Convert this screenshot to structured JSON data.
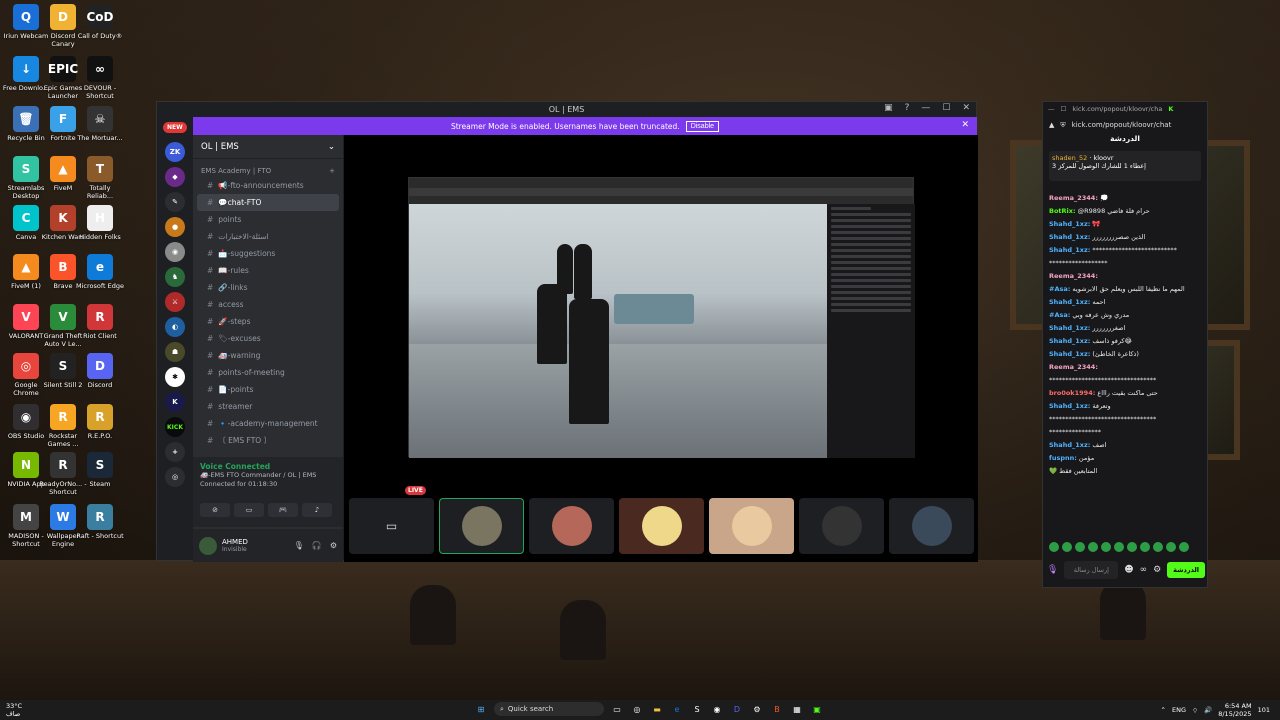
{
  "desktop_icons": [
    {
      "label": "Iriun Webcam",
      "color": "#1a6fd6",
      "glyph": "Q"
    },
    {
      "label": "Discord Canary",
      "color": "#f0b232",
      "glyph": "D"
    },
    {
      "label": "Call of Duty®",
      "color": "#222",
      "glyph": "CoD"
    },
    {
      "label": "Free Downlo...",
      "color": "#1787e0",
      "glyph": "↓"
    },
    {
      "label": "Epic Games Launcher",
      "color": "#111",
      "glyph": "EPIC"
    },
    {
      "label": "DEVOUR - Shortcut",
      "color": "#111",
      "glyph": "∞"
    },
    {
      "label": "Recycle Bin",
      "color": "#3b6fb6",
      "glyph": "🗑"
    },
    {
      "label": "Fortnite",
      "color": "#3aa0e8",
      "glyph": "F"
    },
    {
      "label": "The Mortuar...",
      "color": "#333",
      "glyph": "☠"
    },
    {
      "label": "Streamlabs Desktop",
      "color": "#31c3a2",
      "glyph": "S"
    },
    {
      "label": "FiveM",
      "color": "#f58a1f",
      "glyph": "▲"
    },
    {
      "label": "Totally Reliab...",
      "color": "#8a5a2a",
      "glyph": "T"
    },
    {
      "label": "Canva",
      "color": "#00c4cc",
      "glyph": "C"
    },
    {
      "label": "Kitchen Wars",
      "color": "#b3402a",
      "glyph": "K"
    },
    {
      "label": "Hidden Folks",
      "color": "#eee",
      "glyph": "H"
    },
    {
      "label": "FiveM (1)",
      "color": "#f58a1f",
      "glyph": "▲"
    },
    {
      "label": "Brave",
      "color": "#fb542b",
      "glyph": "B"
    },
    {
      "label": "Microsoft Edge",
      "color": "#0f7bd8",
      "glyph": "e"
    },
    {
      "label": "VALORANT",
      "color": "#fd4556",
      "glyph": "V"
    },
    {
      "label": "Grand Theft Auto V Le...",
      "color": "#2a8c3a",
      "glyph": "V"
    },
    {
      "label": "Riot Client",
      "color": "#d13639",
      "glyph": "R"
    },
    {
      "label": "Google Chrome",
      "color": "#e8453c",
      "glyph": "◎"
    },
    {
      "label": "Silent Still 2",
      "color": "#222",
      "glyph": "S"
    },
    {
      "label": "Discord",
      "color": "#5865f2",
      "glyph": "D"
    },
    {
      "label": "OBS Studio",
      "color": "#302e31",
      "glyph": "◉"
    },
    {
      "label": "Rockstar Games ...",
      "color": "#f6a623",
      "glyph": "R"
    },
    {
      "label": "R.E.P.O.",
      "color": "#d8a22a",
      "glyph": "R"
    },
    {
      "label": "NVIDIA App",
      "color": "#76b900",
      "glyph": "N"
    },
    {
      "label": "ReadyOrNo... - Shortcut",
      "color": "#333",
      "glyph": "R"
    },
    {
      "label": "Steam",
      "color": "#1b2838",
      "glyph": "S"
    },
    {
      "label": "MADISON - Shortcut",
      "color": "#444",
      "glyph": "M"
    },
    {
      "label": "Wallpaper Engine",
      "color": "#2c7be5",
      "glyph": "W"
    },
    {
      "label": "Raft - Shortcut",
      "color": "#3a7fa0",
      "glyph": "R"
    }
  ],
  "discord": {
    "window_title": "OL | EMS",
    "streamer_banner": "Streamer Mode is enabled. Usernames have been truncated.",
    "disable_label": "Disable",
    "new_tag": "NEW",
    "server_name": "OL | EMS",
    "category": "EMS Academy | FTO",
    "channels": [
      {
        "name": "📢-fto-announcements",
        "active": false
      },
      {
        "name": "💬chat-FTO",
        "active": true
      },
      {
        "name": "points",
        "active": false
      },
      {
        "name": "اسئلة-الاختبارات",
        "active": false
      },
      {
        "name": "📩-suggestions",
        "active": false
      },
      {
        "name": "📖-rules",
        "active": false
      },
      {
        "name": "🔗-links",
        "active": false
      },
      {
        "name": "access",
        "active": false
      },
      {
        "name": "🚀-steps",
        "active": false
      },
      {
        "name": "🏷-excuses",
        "active": false
      },
      {
        "name": "🚑-warning",
        "active": false
      },
      {
        "name": "points-of-meeting",
        "active": false
      },
      {
        "name": "📄-points",
        "active": false
      },
      {
        "name": "streamer",
        "active": false
      },
      {
        "name": "🔹-academy-management",
        "active": false
      },
      {
        "name": "〔 EMS FTO 〕",
        "active": false
      }
    ],
    "voice": {
      "title": "Voice Connected",
      "channel": "🚑-EMS FTO Commander / OL | EMS",
      "timer": "Connected for 01:18:30"
    },
    "user": {
      "name": "AHMED",
      "status": "Invisible"
    },
    "live_label": "LIVE"
  },
  "kick": {
    "url": "kick.com/popout/kloovr/chat",
    "header": "الدردشة",
    "pinned": {
      "user": "shaden_52",
      "streamer": "kloovr",
      "text": "إعطاء 1 للشارك الوصول للمركز 3"
    },
    "messages": [
      {
        "user": "Reema_2344:",
        "text": "💭",
        "color": "#f4a3c0"
      },
      {
        "user": "BotRix:",
        "text": "@R9898 حرام فلة فاضي",
        "color": "#53fc18"
      },
      {
        "user": "Shahd_1xz:",
        "text": "🎀",
        "color": "#4fb3ff"
      },
      {
        "user": "Shahd_1xz:",
        "text": "الذين صصرررررررر",
        "color": "#4fb3ff"
      },
      {
        "user": "Shahd_1xz:",
        "text": "**************************",
        "color": "#4fb3ff"
      },
      {
        "user": "",
        "text": "******************",
        "color": "#e8e8e8"
      },
      {
        "user": "Reema_2344:",
        "text": "",
        "color": "#f4a3c0"
      },
      {
        "user": "#Asa:",
        "text": "المهم ما نظيفا اللبس ويعلم حق الابرشويه",
        "color": "#4fb3ff"
      },
      {
        "user": "Shahd_1xz:",
        "text": "احمه",
        "color": "#4fb3ff"
      },
      {
        "user": "#Asa:",
        "text": "مدري وش عرفه وبي",
        "color": "#4fb3ff"
      },
      {
        "user": "Shahd_1xz:",
        "text": "اصغررررررر",
        "color": "#4fb3ff"
      },
      {
        "user": "Shahd_1xz:",
        "text": "كرفو ذاسف😂",
        "color": "#4fb3ff"
      },
      {
        "user": "Shahd_1xz:",
        "text": "(ذكاعرة الخاطئ)",
        "color": "#4fb3ff"
      },
      {
        "user": "Reema_2344:",
        "text": "",
        "color": "#f4a3c0"
      },
      {
        "user": "",
        "text": "*********************************",
        "color": "#e8e8e8"
      },
      {
        "user": "bro0ok1994:",
        "text": "حتى ماكنت بقيت راااع",
        "color": "#ff6b6b"
      },
      {
        "user": "Shahd_1xz:",
        "text": "وتعرفة",
        "color": "#4fb3ff"
      },
      {
        "user": "",
        "text": "*********************************",
        "color": "#e8e8e8"
      },
      {
        "user": "",
        "text": "****************",
        "color": "#e8e8e8"
      },
      {
        "user": "Shahd_1xz:",
        "text": "اصف",
        "color": "#4fb3ff"
      },
      {
        "user": "fuspnn:",
        "text": "مؤمن",
        "color": "#4fb3ff"
      },
      {
        "user": "",
        "text": "💚 المتابعين فقط",
        "color": "#e8e8e8"
      }
    ],
    "input_placeholder": "إرسال رسالة",
    "send_label": "الدردشة"
  },
  "taskbar": {
    "temp": "33°C",
    "weather": "صاف",
    "search_placeholder": "Quick search",
    "time": "6:54 AM",
    "date": "8/15/2025",
    "lang": "ENG",
    "notif_count": "101"
  },
  "colors": {
    "discord_purple": "#7c3aed",
    "discord_green": "#23a55a",
    "kick_green": "#53fc18"
  }
}
